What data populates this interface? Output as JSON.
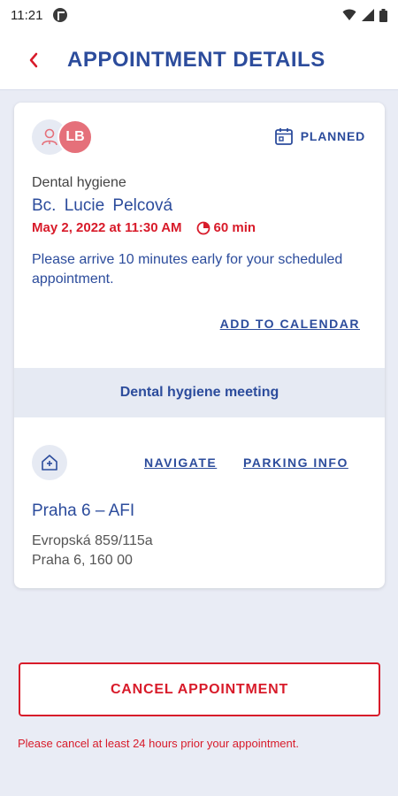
{
  "status_bar": {
    "time": "11:21",
    "icons": [
      "app-badge-icon",
      "wifi-icon",
      "signal-icon",
      "battery-icon"
    ]
  },
  "header": {
    "title": "APPOINTMENT DETAILS",
    "back_icon": "chevron-left-icon"
  },
  "appointment": {
    "avatar_initials": "LB",
    "status": "PLANNED",
    "service": "Dental hygiene",
    "doctor": "Bc.  Lucie Pelcová",
    "datetime": "May 2, 2022 at 11:30 AM",
    "duration": "60 min",
    "note": "Please arrive 10 minutes early for your scheduled appointment.",
    "add_to_calendar": "ADD TO CALENDAR"
  },
  "meeting": {
    "title": "Dental hygiene meeting"
  },
  "location": {
    "navigate": "NAVIGATE",
    "parking_info": "PARKING INFO",
    "clinic_name": "Praha 6 – AFI",
    "address_line1": "Evropská 859/115a",
    "address_line2": "Praha 6, 160 00"
  },
  "cancel": {
    "button_label": "CANCEL APPOINTMENT",
    "note": "Please cancel at least 24 hours prior your appointment."
  },
  "colors": {
    "primary": "#2c4c9c",
    "danger": "#d81b2a",
    "background": "#e9ecf5",
    "avatar": "#e5707a"
  }
}
